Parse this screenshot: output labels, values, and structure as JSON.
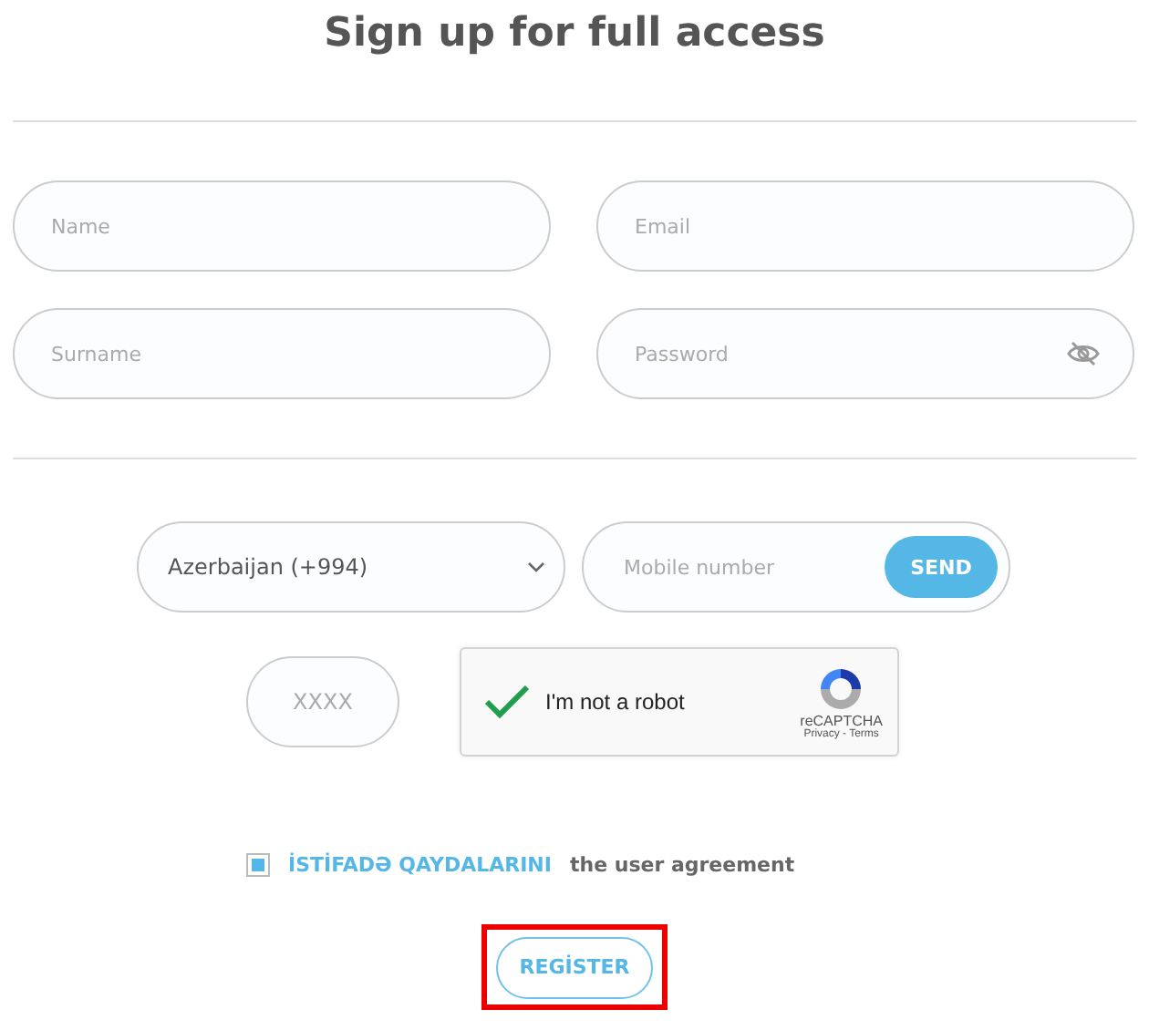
{
  "title": "Sign up for full access",
  "fields": [
    {
      "placeholder": "Name",
      "kind": "text"
    },
    {
      "placeholder": "Email",
      "kind": "text"
    },
    {
      "placeholder": "Surname",
      "kind": "text"
    },
    {
      "placeholder": "Password",
      "kind": "password"
    }
  ],
  "country_select": {
    "value": "Azerbaijan (+994)"
  },
  "mobile": {
    "placeholder": "Mobile number",
    "button": "SEND"
  },
  "code": {
    "placeholder": "XXXX"
  },
  "captcha": {
    "label": "I'm not a robot",
    "checked": true,
    "brand": "reCAPTCHA",
    "links": "Privacy - Terms"
  },
  "agreement": {
    "checked": true,
    "link": "İSTİFADƏ QAYDALARINI",
    "text": "the user agreement"
  },
  "register": {
    "label": "REGİSTER",
    "highlighted": true
  }
}
